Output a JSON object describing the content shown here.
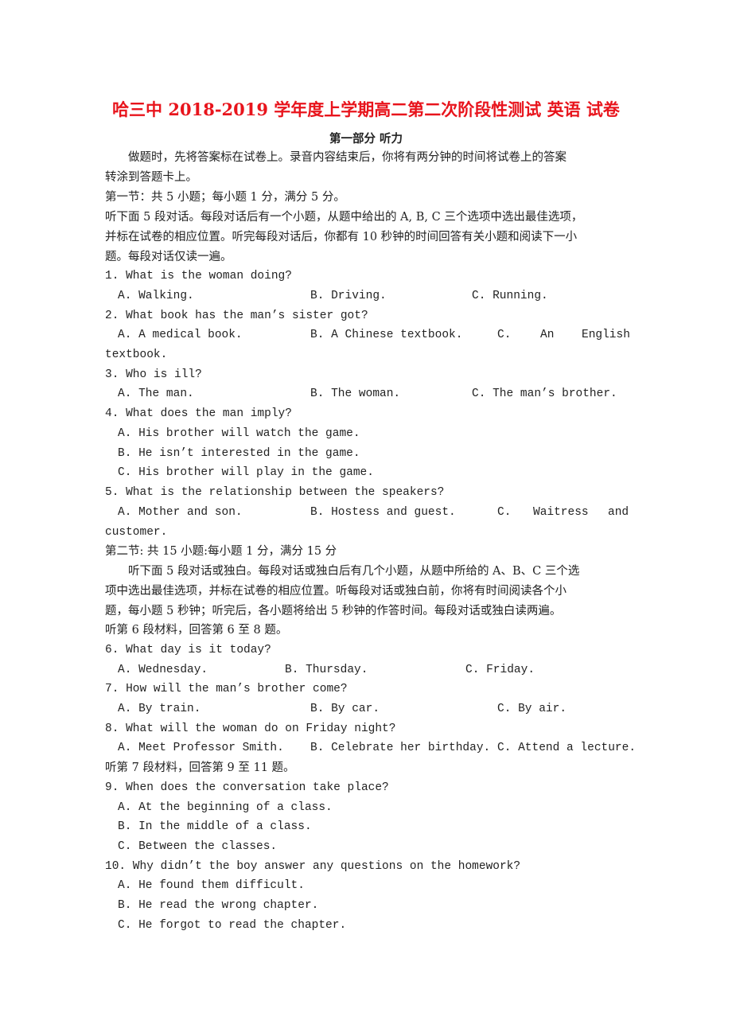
{
  "title": "哈三中 2018-2019 学年度上学期高二第二次阶段性测试 英语 试卷",
  "part_heading": "第一部分   听力",
  "intro": [
    "　　做题时，先将答案标在试卷上。录音内容结束后，你将有两分钟的时间将试卷上的答案",
    "转涂到答题卡上。"
  ],
  "section1": {
    "heading": "第一节：共 5 小题；每小题 1 分，满分 5 分。",
    "instructions": [
      "听下面 5 段对话。每段对话后有一个小题，从题中给出的 A, B, C 三个选项中选出最佳选项，",
      "并标在试卷的相应位置。听完每段对话后，你都有 10 秒钟的时间回答有关小题和阅读下一小",
      "题。每段对话仅读一遍。"
    ]
  },
  "q1": {
    "q": "1. What is the woman doing?",
    "a": "A. Walking.",
    "b": "B. Driving.",
    "c": "C. Running."
  },
  "q2": {
    "q": "2. What book has the man’s sister got?",
    "a": "A. A medical book.",
    "b": "B. A Chinese textbook.",
    "c1": "C.",
    "c2": "An",
    "c3": "English",
    "cont": "textbook."
  },
  "q3": {
    "q": "3. Who is ill?",
    "a": "A. The man.",
    "b": "B. The woman.",
    "c": "C. The man’s brother."
  },
  "q4": {
    "q": "4. What does the man imply?",
    "a": "A. His brother will watch the game.",
    "b": "B. He isn’t interested in the game.",
    "c": "C. His brother will play in the game."
  },
  "q5": {
    "q": "5. What is the relationship between the speakers?",
    "a": "A. Mother and son.",
    "b": "B. Hostess and guest.",
    "c1": "C.",
    "c2": "Waitress",
    "c3": "and",
    "cont": "customer."
  },
  "section2": {
    "heading": "第二节: 共 15 小题:每小题 1 分，满分 15 分",
    "instructions": [
      "　　听下面 5 段对话或独白。每段对话或独白后有几个小题，从题中所给的 A、B、C 三个选",
      "项中选出最佳选项，并标在试卷的相应位置。听每段对话或独白前，你将有时间阅读各个小",
      "题，每小题 5 秒钟；听完后，各小题将给出 5 秒钟的作答时间。每段对话或独白读两遍。"
    ],
    "material6": "听第 6 段材料，回答第 6 至 8 题。",
    "material7": "听第 7 段材料，回答第 9 至 11 题。"
  },
  "q6": {
    "q": "6. What day is it today?",
    "a": "A. Wednesday.",
    "b": "B. Thursday.",
    "c": "C. Friday."
  },
  "q7": {
    "q": "7. How will the man’s brother come?",
    "a": "A. By train.",
    "b": "B. By car.",
    "c": "C. By air."
  },
  "q8": {
    "q": "8. What will the woman do on Friday night?",
    "a": "A. Meet Professor Smith.",
    "b": "B. Celebrate her birthday.",
    "c": "C. Attend a lecture."
  },
  "q9": {
    "q": "9. When does the conversation take place?",
    "a": "A. At the beginning of a class.",
    "b": "B. In the middle of a class.",
    "c": "C. Between the classes."
  },
  "q10": {
    "q": "10. Why didn’t the boy answer any questions on the homework?",
    "a": "A. He found them difficult.",
    "b": "B. He read the wrong chapter.",
    "c": "C. He forgot to read the chapter."
  }
}
